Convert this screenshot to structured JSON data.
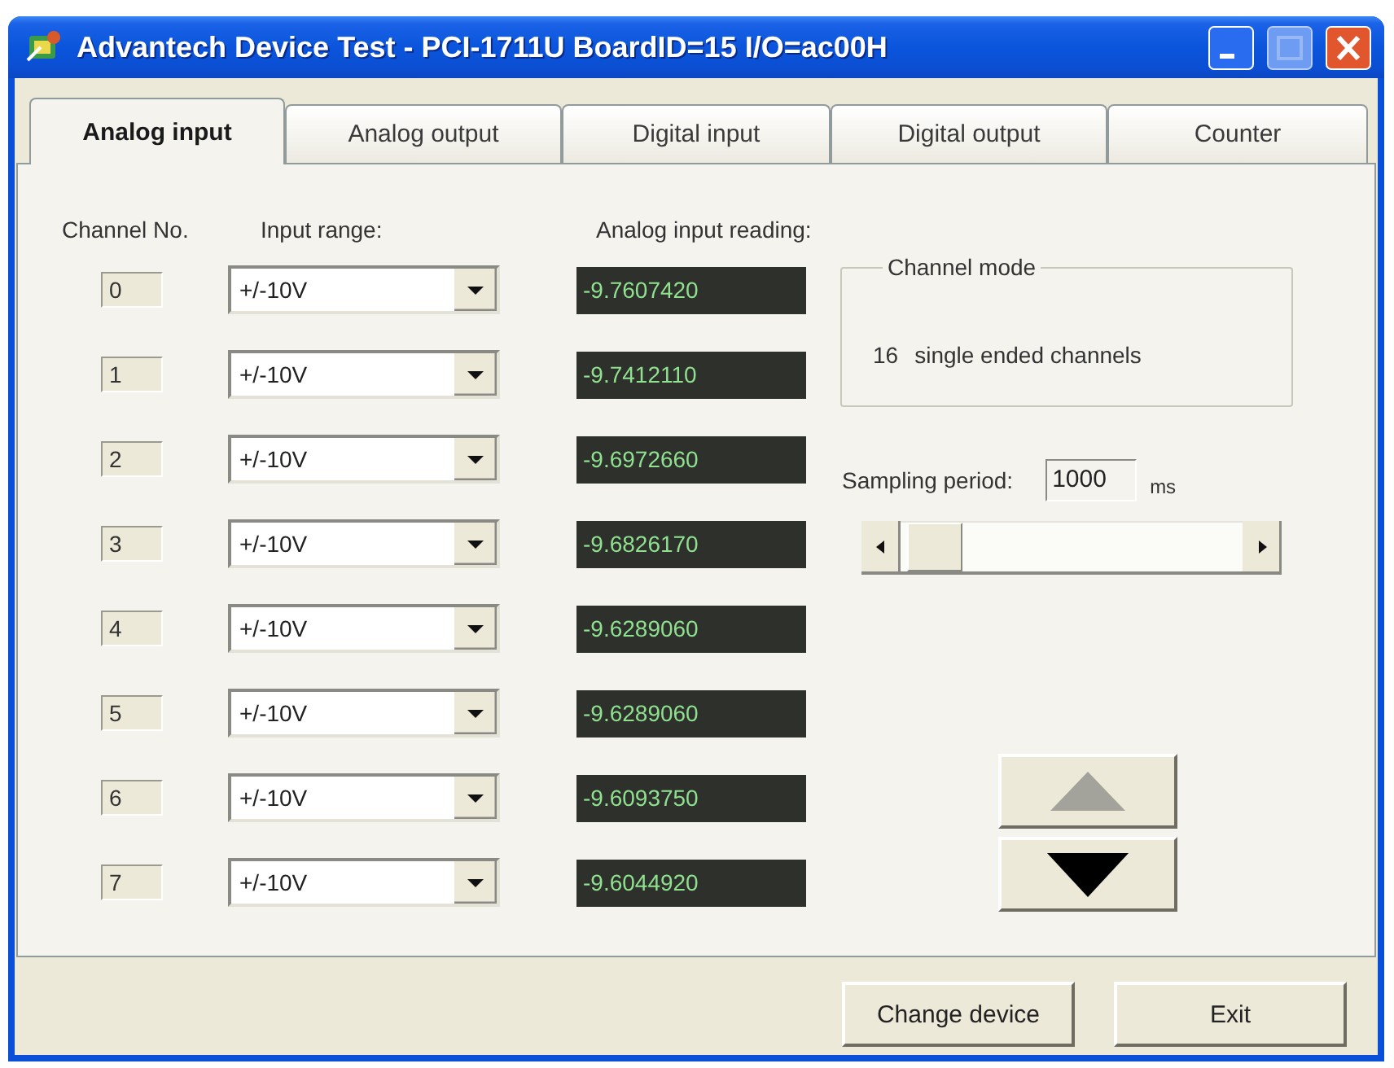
{
  "window": {
    "title": "Advantech Device Test - PCI-1711U BoardID=15 I/O=ac00H",
    "maximize_disabled": true
  },
  "tabs": [
    {
      "label": "Analog input",
      "selected": true
    },
    {
      "label": "Analog output",
      "selected": false
    },
    {
      "label": "Digital input",
      "selected": false
    },
    {
      "label": "Digital output",
      "selected": false
    },
    {
      "label": "Counter",
      "selected": false
    }
  ],
  "columns": {
    "channel": "Channel No.",
    "range": "Input range:",
    "reading": "Analog input reading:"
  },
  "channels": [
    {
      "number": "0",
      "range": "+/-10V",
      "reading": "-9.7607420"
    },
    {
      "number": "1",
      "range": "+/-10V",
      "reading": "-9.7412110"
    },
    {
      "number": "2",
      "range": "+/-10V",
      "reading": "-9.6972660"
    },
    {
      "number": "3",
      "range": "+/-10V",
      "reading": "-9.6826170"
    },
    {
      "number": "4",
      "range": "+/-10V",
      "reading": "-9.6289060"
    },
    {
      "number": "5",
      "range": "+/-10V",
      "reading": "-9.6289060"
    },
    {
      "number": "6",
      "range": "+/-10V",
      "reading": "-9.6093750"
    },
    {
      "number": "7",
      "range": "+/-10V",
      "reading": "-9.6044920"
    }
  ],
  "channel_mode": {
    "title": "Channel mode",
    "count": "16",
    "description": "single ended channels"
  },
  "sampling": {
    "label": "Sampling period:",
    "value": "1000",
    "unit": "ms",
    "level": 0.02
  },
  "step_buttons": [
    {
      "kind": "up",
      "disabled": true
    },
    {
      "kind": "down",
      "disabled": false
    }
  ],
  "buttons": [
    {
      "label": "Change device"
    },
    {
      "label": "Exit"
    }
  ]
}
